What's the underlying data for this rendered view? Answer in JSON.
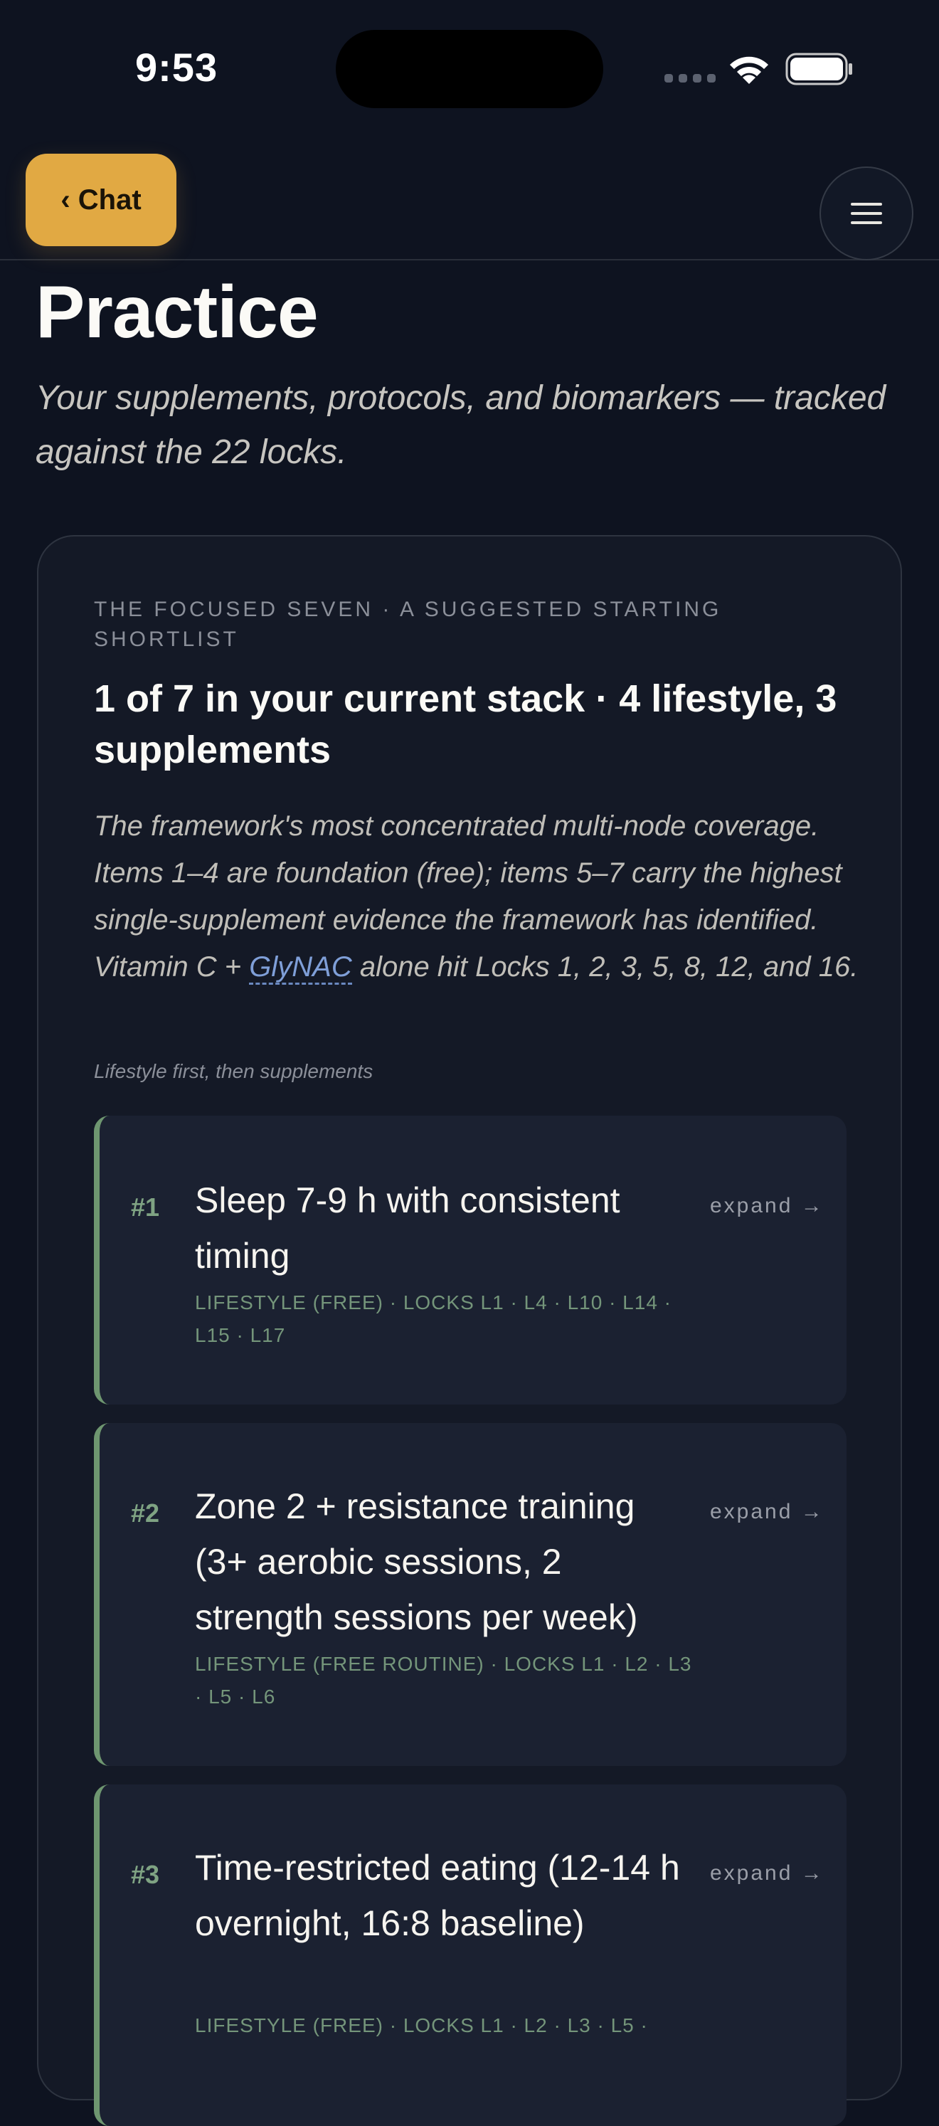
{
  "status_bar": {
    "time": "9:53"
  },
  "nav": {
    "back_label": "‹ Chat"
  },
  "page": {
    "title": "Practice",
    "subtitle": "Your supplements, protocols, and biomarkers — tracked against the 22 locks."
  },
  "card": {
    "eyebrow": "THE FOCUSED SEVEN · A SUGGESTED STARTING SHORTLIST",
    "heading": "1 of 7 in your current stack · 4 lifestyle, 3 supplements",
    "desc_before_link": "The framework's most concentrated multi-node coverage. Items 1–4 are foundation (free); items 5–7 carry the highest single-supplement evidence the framework has identified. Vitamin C + ",
    "desc_link": "GlyNAC",
    "desc_after_link": " alone hit Locks 1, 2, 3, 5, 8, 12, and 16.",
    "section_note": "Lifestyle first, then supplements",
    "items": [
      {
        "num": "#1",
        "title": "Sleep 7-9 h with consistent timing",
        "meta": "LIFESTYLE (FREE) · LOCKS L1 · L4 · L10 · L14 · L15 · L17",
        "expand": "expand →"
      },
      {
        "num": "#2",
        "title": "Zone 2 + resistance training (3+ aerobic sessions, 2 strength sessions per week)",
        "meta": "LIFESTYLE (FREE ROUTINE) · LOCKS L1 · L2 · L3 · L5 · L6",
        "expand": "expand →"
      },
      {
        "num": "#3",
        "title": "Time-restricted eating (12-14 h overnight, 16:8 baseline)",
        "meta": "LIFESTYLE (FREE) · LOCKS L1 · L2 · L3 · L5 ·",
        "expand": "expand →"
      }
    ]
  },
  "colors": {
    "background": "#0e1320",
    "accent": "#e1a943",
    "lifestyle_green": "#6e9670",
    "link_blue": "#7f9fd8"
  }
}
